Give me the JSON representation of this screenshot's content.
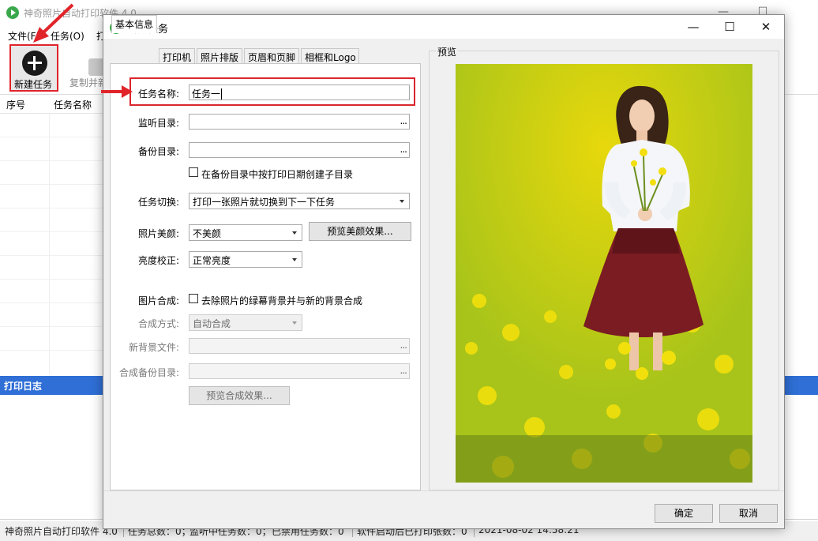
{
  "main_window": {
    "title": "神奇照片自动打印软件 4.0",
    "menu": [
      "文件(F)",
      "任务(O)",
      "打"
    ],
    "toolbar": {
      "new_task": "新建任务",
      "copy_task": "复制并新"
    },
    "columns": [
      "序号",
      "任务名称"
    ],
    "log_title": "打印日志",
    "status": {
      "app": "神奇照片自动打印软件 4.0",
      "total": "任务总数：0；",
      "monitoring": "监听中任务数：0；",
      "disabled": "已禁用任务数：0",
      "printed": "软件启动后已打印张数：0",
      "time": "2021-08-02 14:58:21"
    }
  },
  "dialog": {
    "title": "新建任务",
    "tabs": [
      "基本信息",
      "打印机",
      "照片排版",
      "页眉和页脚",
      "相框和Logo"
    ],
    "form": {
      "task_name_label": "任务名称:",
      "task_name_value": "任务一",
      "watch_dir_label": "监听目录:",
      "backup_dir_label": "备份目录:",
      "browse": "...",
      "backup_subdir_check": "在备份目录中按打印日期创建子目录",
      "switch_label": "任务切换:",
      "switch_value": "打印一张照片就切换到下一下任务",
      "beauty_label": "照片美颜:",
      "beauty_value": "不美颜",
      "beauty_preview_btn": "预览美颜效果...",
      "brightness_label": "亮度校正:",
      "brightness_value": "正常亮度",
      "compose_label": "图片合成:",
      "compose_check": "去除照片的绿幕背景并与新的背景合成",
      "compose_mode_label": "合成方式:",
      "compose_mode_value": "自动合成",
      "new_bg_label": "新背景文件:",
      "compose_backup_label": "合成备份目录:",
      "compose_preview_btn": "预览合成效果..."
    },
    "preview_label": "预览",
    "ok": "确定",
    "cancel": "取消"
  },
  "colors": {
    "accent_red": "#d9262c",
    "log_header_blue": "#2f6fd6"
  }
}
